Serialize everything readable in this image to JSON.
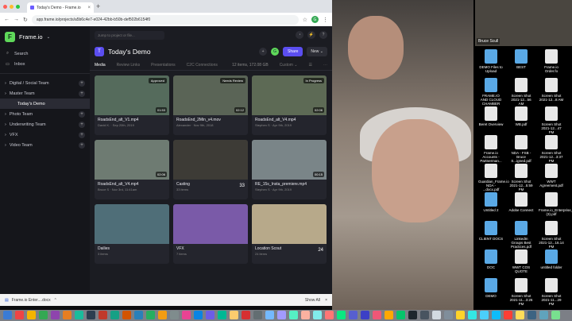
{
  "browser": {
    "tab_title": "Today's Demo - Frame.io",
    "url": "app.frame.io/projects/a5b6c4e7-e024-42bb-b50b-def502b6154f0",
    "profile": "G"
  },
  "sidebar": {
    "brand": "Frame.io",
    "search": "Search",
    "inbox": "Inbox",
    "items": [
      {
        "label": "Digital / Social Team",
        "type": "team"
      },
      {
        "label": "Master Team",
        "type": "team"
      },
      {
        "label": "Today's Demo",
        "type": "project",
        "selected": true
      },
      {
        "label": "Photo Team",
        "type": "team"
      },
      {
        "label": "Underwriting Team",
        "type": "team"
      },
      {
        "label": "VFX",
        "type": "team"
      },
      {
        "label": "Video Team",
        "type": "team"
      }
    ]
  },
  "topbar": {
    "jump_placeholder": "Jump to project or file..."
  },
  "project": {
    "initial": "T",
    "title": "Today's Demo",
    "share": "Share",
    "new": "New",
    "user_initial": "G"
  },
  "tabs": [
    "Media",
    "Review Links",
    "Presentations",
    "C2C Connections"
  ],
  "meta": {
    "items": "12 items, 172.08 GB",
    "sort": "Custom"
  },
  "cards": [
    {
      "name": "RoadsEnd_alt_V1.mp4",
      "meta": "David K. · Sep 20th, 2019",
      "status": "Approved",
      "duration": "01:53",
      "bg": "#556b5c"
    },
    {
      "name": "RoadsEnd_2Min_v4.mov",
      "meta": "Alexander · Nov 9th, 2018",
      "status": "Needs Review",
      "duration": "02:12",
      "bg": "#5a6456"
    },
    {
      "name": "RoadsEnd_alt_V4.mp4",
      "meta": "Stephen S · Apr 9th, 2019",
      "status": "In Progress",
      "duration": "02:06",
      "bg": "#5d6a55"
    },
    {
      "name": "RoadsEnd_alt_V4.mp4",
      "meta": "Bruce S · Nov 3rd, 11:41am",
      "status": "",
      "duration": "02:06",
      "bg": "#6e7b72"
    },
    {
      "name": "Casting",
      "meta": "33 items",
      "status": "",
      "duration": "",
      "count": "33",
      "bg": "#3d3b36"
    },
    {
      "name": "RE_15s_Insta_premiere.mp4",
      "meta": "Stephen S · Apr 9th, 2019",
      "status": "",
      "duration": "00:15",
      "bg": "#7a8588"
    },
    {
      "name": "Dailies",
      "meta": "3 items",
      "status": "",
      "duration": "",
      "bg": "#4f6e78"
    },
    {
      "name": "VFX",
      "meta": "7 items",
      "status": "",
      "duration": "",
      "bg": "#7a5aa8"
    },
    {
      "name": "Location Scout",
      "meta": "24 items",
      "status": "",
      "duration": "",
      "count": "24",
      "bg": "#b7a98a"
    }
  ],
  "download": {
    "file": "Frame.io Enter....docx",
    "show_all": "Show All"
  },
  "desktop": {
    "files": [
      "DEMO Files to Upload",
      "BEST",
      "Frame.io Order.fo",
      "FRAME.IO AND CLOUD CHAMBER",
      "Screen Shot 2021-12...56 AM",
      "Screen Shot 2021-12...8 AM",
      "Beret Overview",
      "WB.pdf",
      "Screen Shot 2021-12...47 PM",
      "Frame.io Accounts - Partnerman...",
      "NDA - FSB - Bruce S...igned.pdf",
      "Screen Shot 2021-12...3:37 PM",
      "Guardian_Frame.io NDA - ...docx.pdf",
      "Screen Shot 2021-12...5:59 PM",
      "WWT Agreement.pdf",
      "Untitled 2",
      "Adobe Connect",
      "Frame.io_Enterprise_Agree...(3).pdf",
      "CLIENT DOCS",
      "LinkedIn Groups Best Practices.pdf",
      "Screen Shot 2021-12...16.14 PM",
      "DOC",
      "WWT COS QUOTE",
      "untitled folder",
      "DEMO",
      "Screen Shot 2021-11...3:26 PM",
      "Screen Shot 2021-11...29 PM"
    ],
    "cam_name": "Bruce Scull"
  }
}
